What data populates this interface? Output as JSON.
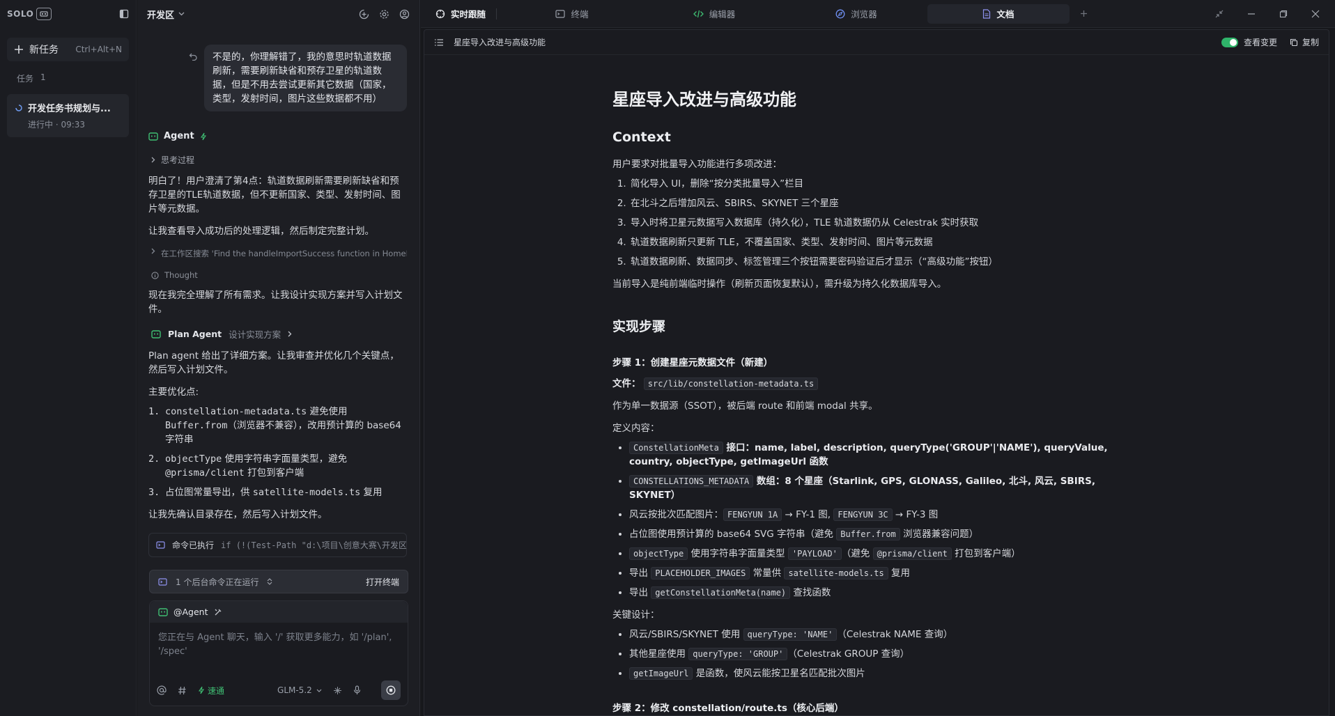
{
  "sidebar": {
    "logo_text": "SOLO",
    "new_task_label": "新任务",
    "new_task_shortcut": "Ctrl+Alt+N",
    "tasks_label": "任务",
    "tasks_count": "1",
    "task": {
      "title": "开发任务书规划与...",
      "status": "进行中 · 09:33"
    }
  },
  "chat": {
    "workspace": "开发区",
    "user_message": "不是的，你理解错了，我的意思时轨道数据刷新，需要刷新缺省和预存卫星的轨道数据，但是不用去尝试更新其它数据（国家，类型，发射时间，图片这些数据都不用）",
    "agent_label": "Agent",
    "thinking_label": "思考过程",
    "p1": "明白了！用户澄清了第4点：轨道数据刷新需要刷新缺省和预存卫星的TLE轨道数据，但不更新国家、类型、发射时间、图片等元数据。",
    "p2": "让我查看导入成功后的处理逻辑，然后制定完整计划。",
    "search_line": "在工作区搜索 'Find the handleImportSuccess function in HomePage...",
    "thought_label": "Thought",
    "p3": "现在我完全理解了所有需求。让我设计实现方案并写入计划文件。",
    "plan_agent_label": "Plan Agent",
    "plan_agent_desc": "设计实现方案",
    "p4": "Plan agent 给出了详细方案。让我审查并优化几个关键点，然后写入计划文件。",
    "p5": "主要优化点:",
    "opt1_num": "1.",
    "opt1_code1": "constellation-metadata.ts",
    "opt1_t1": " 避免使用 ",
    "opt1_code2": "Buffer.from",
    "opt1_t2": "（浏览器不兼容），改用预计算的 base64 字符串",
    "opt2_num": "2.",
    "opt2_code1": "objectType",
    "opt2_t1": " 使用字符串字面量类型，避免 ",
    "opt2_code2": "@prisma/client",
    "opt2_t2": " 打包到客户端",
    "opt3_num": "3.",
    "opt3_t1": "占位图常量导出，供 ",
    "opt3_code1": "satellite-models.ts",
    "opt3_t2": " 复用",
    "p6": "让我先确认目录存在，然后写入计划文件。",
    "cmd_label": "命令已执行",
    "cmd_text": "if (!(Test-Path \"d:\\项目\\创意大赛\\开发区\\.trae\\do...",
    "bg_run_label": "1 个后台命令正在运行",
    "open_terminal": "打开终端",
    "input_agent": "@Agent",
    "input_placeholder": "您正在与 Agent 聊天，输入 '/' 获取更多能力，如 '/plan', '/spec'",
    "fast_label": "速通",
    "model": "GLM-5.2"
  },
  "tabs": [
    {
      "label": "实时跟随",
      "icon": "target-icon"
    },
    {
      "label": "终端",
      "icon": "terminal-icon"
    },
    {
      "label": "编辑器",
      "icon": "code-icon"
    },
    {
      "label": "浏览器",
      "icon": "compass-icon"
    },
    {
      "label": "文档",
      "icon": "file-icon",
      "active": true
    }
  ],
  "doc": {
    "bar_title": "星座导入改进与高级功能",
    "view_changes": "查看变更",
    "copy": "复制",
    "h1": "星座导入改进与高级功能",
    "h2_context": "Context",
    "context_intro": "用户要求对批量导入功能进行多项改进：",
    "ctx_items": [
      "简化导入 UI，删除“按分类批量导入”栏目",
      "在北斗之后增加风云、SBIRS、SKYNET 三个星座",
      "导入时将卫星元数据写入数据库（持久化），TLE 轨道数据仍从 Celestrak 实时获取",
      "轨道数据刷新只更新 TLE，不覆盖国家、类型、发射时间、图片等元数据",
      "轨道数据刷新、数据同步、标签管理三个按钮需要密码验证后才显示（“高级功能”按钮）"
    ],
    "context_outro": "当前导入是纯前端临时操作（刷新页面恢复默认），需升级为持久化数据库导入。",
    "h2_steps": "实现步骤",
    "step1_title": "步骤 1：创建星座元数据文件（新建）",
    "file_label": "文件：",
    "file_path": "src/lib/constellation-metadata.ts",
    "ssot": "作为单一数据源（SSOT），被后端 route 和前端 modal 共享。",
    "def_label": "定义内容：",
    "def": {
      "b1_code": "ConstellationMeta",
      "b1_text": " 接口：name, label, description, queryType('GROUP'|'NAME'), queryValue, country, objectType, getImageUrl 函数",
      "b2_code": "CONSTELLATIONS_METADATA",
      "b2_text": " 数组：8 个星座（Starlink, GPS, GLONASS, Galileo, 北斗, 风云, SBIRS, SKYNET）",
      "b3_t1": "风云按批次匹配图片：",
      "b3_c1": "FENGYUN 1A",
      "b3_t2": " → FY-1 图, ",
      "b3_c2": "FENGYUN 3C",
      "b3_t3": " → FY-3 图",
      "b4_t1": "占位图使用预计算的 base64 SVG 字符串（避免 ",
      "b4_c1": "Buffer.from",
      "b4_t2": " 浏览器兼容问题）",
      "b5_c1": "objectType",
      "b5_t1": " 使用字符串字面量类型 ",
      "b5_c2": "'PAYLOAD'",
      "b5_t2": "（避免 ",
      "b5_c3": "@prisma/client",
      "b5_t3": " 打包到客户端）",
      "b6_t1": "导出 ",
      "b6_c1": "PLACEHOLDER_IMAGES",
      "b6_t2": " 常量供 ",
      "b6_c2": "satellite-models.ts",
      "b6_t3": " 复用",
      "b7_t1": "导出 ",
      "b7_c1": "getConstellationMeta(name)",
      "b7_t2": " 查找函数"
    },
    "key_label": "关键设计：",
    "key": {
      "k1_t1": "风云/SBIRS/SKYNET 使用 ",
      "k1_c1": "queryType: 'NAME'",
      "k1_t2": "（Celestrak NAME 查询）",
      "k2_t1": "其他星座使用 ",
      "k2_c1": "queryType: 'GROUP'",
      "k2_t2": "（Celestrak GROUP 查询）",
      "k3_c1": "getImageUrl",
      "k3_t1": " 是函数，使风云能按卫星名匹配批次图片"
    },
    "step2_title": "步骤 2：修改 constellation/route.ts（核心后端）"
  },
  "colors": {
    "accent_green": "#2fb46a",
    "bg": "#17181c",
    "panel": "#1d1e23"
  }
}
